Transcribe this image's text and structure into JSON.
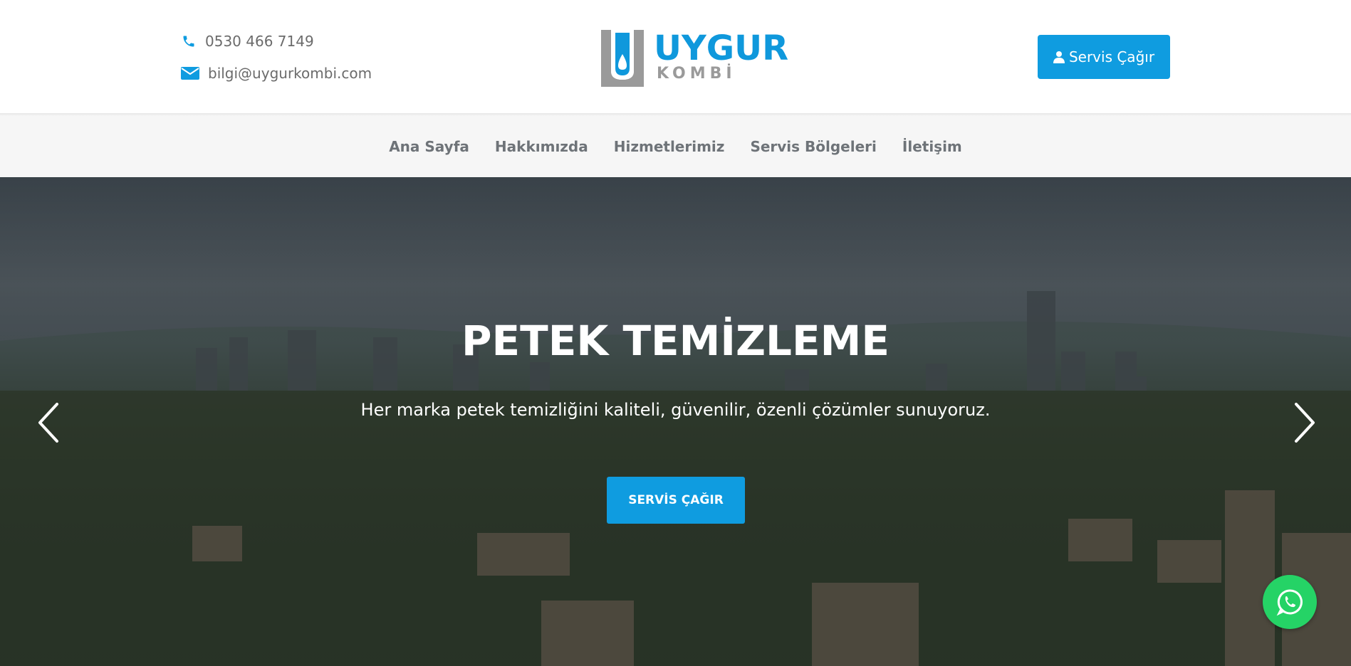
{
  "header": {
    "phone": "0530 466 7149",
    "email": "bilgi@uygurkombi.com",
    "phone_icon": "phone-icon",
    "email_icon": "envelope-icon",
    "logo": {
      "title": "UYGUR",
      "subtitle": "KOMBİ"
    },
    "call_button_label": "Servis Çağır",
    "call_button_icon": "user-icon"
  },
  "nav": {
    "items": [
      {
        "label": "Ana Sayfa"
      },
      {
        "label": "Hakkımızda"
      },
      {
        "label": "Hizmetlerimiz"
      },
      {
        "label": "Servis Bölgeleri"
      },
      {
        "label": "İletişim"
      }
    ]
  },
  "hero": {
    "title": "PETEK TEMİZLEME",
    "subtitle": "Her marka petek temizliğini kaliteli, güvenilir, özenli çözümler sunuyoruz.",
    "button_label": "SERVİS ÇAĞIR",
    "prev_icon": "chevron-left-icon",
    "next_icon": "chevron-right-icon"
  },
  "floating": {
    "whatsapp_icon": "whatsapp-icon"
  },
  "colors": {
    "accent": "#0f9ce0",
    "nav_bg": "#f6f6f6",
    "nav_text": "#6e7378",
    "whatsapp": "#25d366"
  }
}
